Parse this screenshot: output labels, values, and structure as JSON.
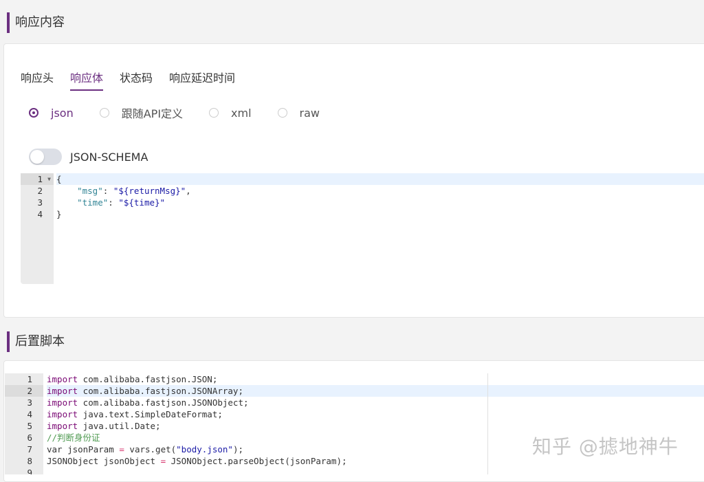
{
  "response_section": {
    "title": "响应内容",
    "tabs": [
      {
        "label": "响应头",
        "active": false
      },
      {
        "label": "响应体",
        "active": true
      },
      {
        "label": "状态码",
        "active": false
      },
      {
        "label": "响应延迟时间",
        "active": false
      }
    ],
    "format_options": [
      {
        "label": "json",
        "checked": true
      },
      {
        "label": "跟随API定义",
        "checked": false
      },
      {
        "label": "xml",
        "checked": false
      },
      {
        "label": "raw",
        "checked": false
      }
    ],
    "schema_toggle": {
      "label": "JSON-SCHEMA",
      "on": false
    },
    "editor": {
      "line_numbers": [
        "1",
        "2",
        "3",
        "4"
      ],
      "lines": [
        [
          {
            "t": "{",
            "c": "plain"
          }
        ],
        [
          {
            "t": "    ",
            "c": "plain"
          },
          {
            "t": "\"msg\"",
            "c": "key"
          },
          {
            "t": ": ",
            "c": "plain"
          },
          {
            "t": "\"${returnMsg}\"",
            "c": "str"
          },
          {
            "t": ",",
            "c": "plain"
          }
        ],
        [
          {
            "t": "    ",
            "c": "plain"
          },
          {
            "t": "\"time\"",
            "c": "key"
          },
          {
            "t": ": ",
            "c": "plain"
          },
          {
            "t": "\"${time}\"",
            "c": "str"
          }
        ],
        [
          {
            "t": "}",
            "c": "plain"
          }
        ]
      ]
    }
  },
  "script_section": {
    "title": "后置脚本",
    "editor": {
      "line_numbers": [
        "1",
        "2",
        "3",
        "4",
        "5",
        "6",
        "7",
        "8",
        "9"
      ],
      "lines": [
        [
          {
            "t": "import",
            "c": "kw"
          },
          {
            "t": " com.alibaba.fastjson.JSON;",
            "c": "plain"
          }
        ],
        [
          {
            "t": "import",
            "c": "kw"
          },
          {
            "t": " com.alibaba.fastjson.JSONArray;",
            "c": "plain"
          }
        ],
        [
          {
            "t": "import",
            "c": "kw"
          },
          {
            "t": " com.alibaba.fastjson.JSONObject;",
            "c": "plain"
          }
        ],
        [
          {
            "t": "import",
            "c": "kw"
          },
          {
            "t": " java.text.SimpleDateFormat;",
            "c": "plain"
          }
        ],
        [
          {
            "t": "import",
            "c": "kw"
          },
          {
            "t": " java.util.Date;",
            "c": "plain"
          }
        ],
        [
          {
            "t": "//判断身份证",
            "c": "cm"
          }
        ],
        [
          {
            "t": "var jsonParam ",
            "c": "plain"
          },
          {
            "t": "=",
            "c": "op"
          },
          {
            "t": " vars.get(",
            "c": "plain"
          },
          {
            "t": "\"body.json\"",
            "c": "str"
          },
          {
            "t": ");",
            "c": "plain"
          }
        ],
        [
          {
            "t": "JSONObject jsonObject ",
            "c": "plain"
          },
          {
            "t": "=",
            "c": "op"
          },
          {
            "t": " JSONObject.parseObject(jsonParam);",
            "c": "plain"
          }
        ],
        [
          {
            "t": "",
            "c": "plain"
          }
        ]
      ]
    }
  },
  "watermark": "知乎 @摅地神牛",
  "colors": {
    "accent": "#6b2f80",
    "key": "#318495",
    "string": "#1a1aa6",
    "keyword": "#7a0874",
    "comment": "#4f9a51"
  }
}
